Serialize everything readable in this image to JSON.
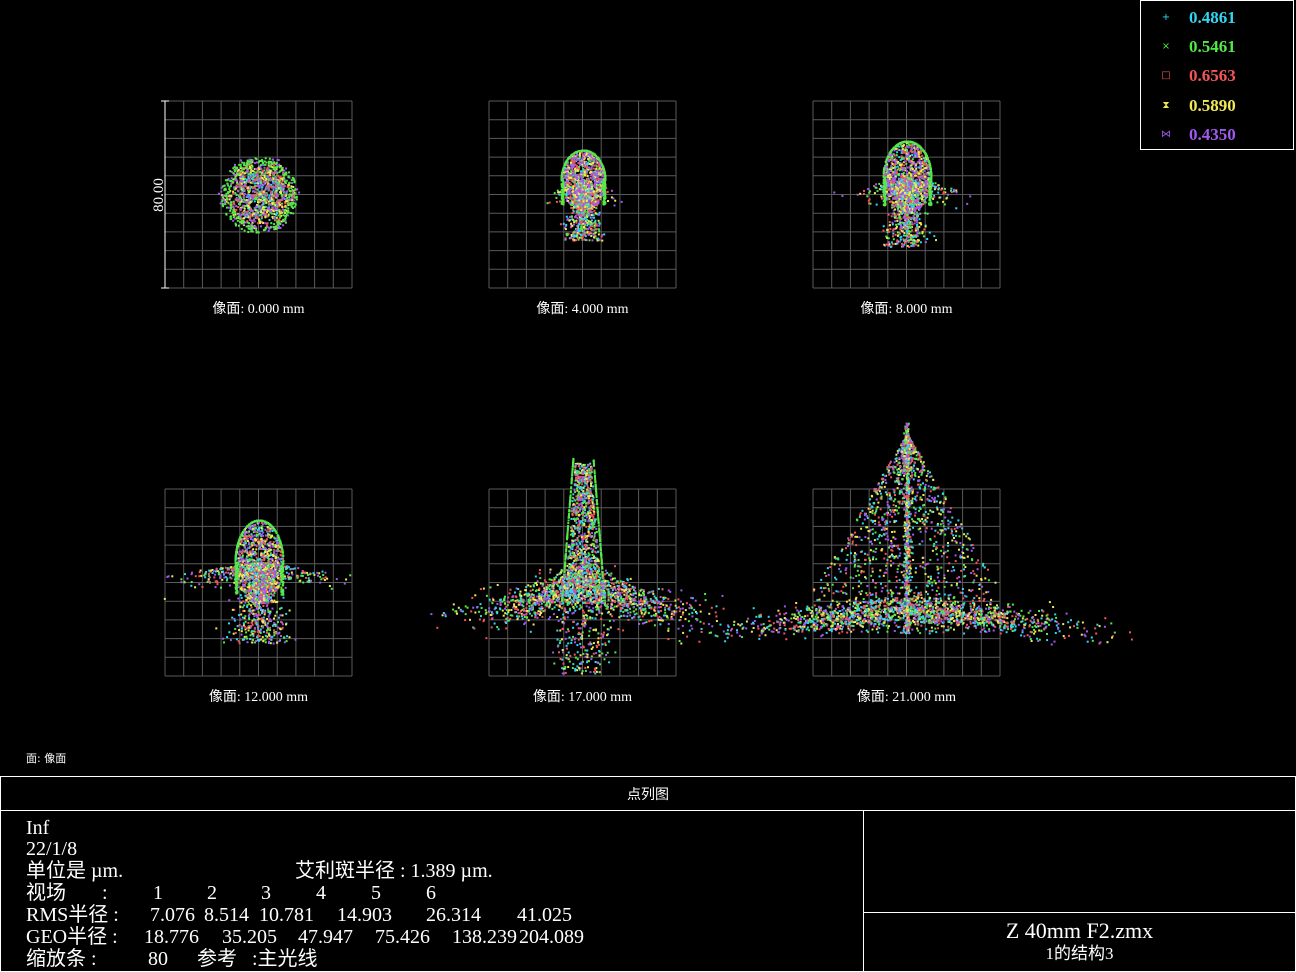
{
  "chart_data": {
    "type": "scatter",
    "title": "点列图",
    "scale_bar_label": "80.00",
    "surface_label": "面: 像面",
    "fields": [
      {
        "label": "像面: 0.000 mm",
        "rms": 7.076,
        "geo": 18.776
      },
      {
        "label": "像面: 4.000 mm",
        "rms": 8.514,
        "geo": 35.205
      },
      {
        "label": "像面: 8.000 mm",
        "rms": 10.781,
        "geo": 47.947
      },
      {
        "label": "像面: 12.000 mm",
        "rms": 14.903,
        "geo": 75.426
      },
      {
        "label": "像面: 17.000 mm",
        "rms": 26.314,
        "geo": 138.239
      },
      {
        "label": "像面: 21.000 mm",
        "rms": 41.025,
        "geo": 204.089
      }
    ],
    "wavelengths": [
      {
        "value": "0.4861",
        "color": "#33d6f2",
        "symbol": "+"
      },
      {
        "value": "0.5461",
        "color": "#55e84a",
        "symbol": "×"
      },
      {
        "value": "0.6563",
        "color": "#f2555a",
        "symbol": "□"
      },
      {
        "value": "0.5890",
        "color": "#f2ea55",
        "symbol": "⧗"
      },
      {
        "value": "0.4350",
        "color": "#a05af0",
        "symbol": "⋈"
      }
    ],
    "grid": true,
    "legend_position": "top-right"
  },
  "info": {
    "line1": "Inf",
    "line2": "22/1/8",
    "units_label": "单位是 µm.",
    "airy_label": "艾利斑半径 : 1.389 µm.",
    "field_label": "视场",
    "field_numbers": [
      "1",
      "2",
      "3",
      "4",
      "5",
      "6"
    ],
    "rms_label": "RMS半径 :",
    "rms_values": [
      "7.076",
      "8.514",
      "10.781",
      "14.903",
      "26.314",
      "41.025"
    ],
    "geo_label": "GEO半径 :",
    "geo_values": [
      "18.776",
      "35.205",
      "47.947",
      "75.426",
      "138.239",
      "204.089"
    ],
    "scale_label": "缩放条 :",
    "scale_value": "80",
    "ref_label": "参考",
    "ref_value": ":主光线"
  },
  "file": {
    "name": "Z 40mm F2.zmx",
    "config": "1的结构3"
  }
}
